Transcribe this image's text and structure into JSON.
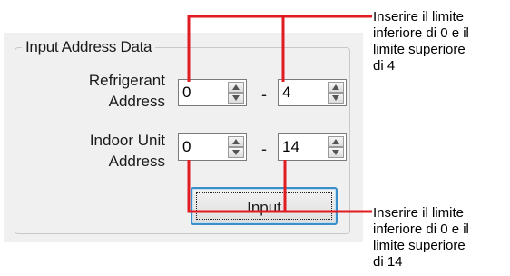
{
  "group": {
    "title": "Input Address Data"
  },
  "refrigerant": {
    "label_line1": "Refrigerant",
    "label_line2": "Address",
    "lower": "0",
    "upper": "4",
    "separator": "-"
  },
  "indoor": {
    "label_line1": "Indoor Unit",
    "label_line2": "Address",
    "lower": "0",
    "upper": "14",
    "separator": "-"
  },
  "button": {
    "label": "Input"
  },
  "callouts": {
    "top": [
      "Inserire il limite",
      "inferiore di 0 e il",
      "limite superiore",
      "di 4"
    ],
    "bottom": [
      "Inserire il limite",
      "inferiore di 0 e il",
      "limite superiore",
      "di 14"
    ]
  },
  "colors": {
    "callout_line": "#e11b22",
    "focus_border": "#3c8ec8"
  }
}
